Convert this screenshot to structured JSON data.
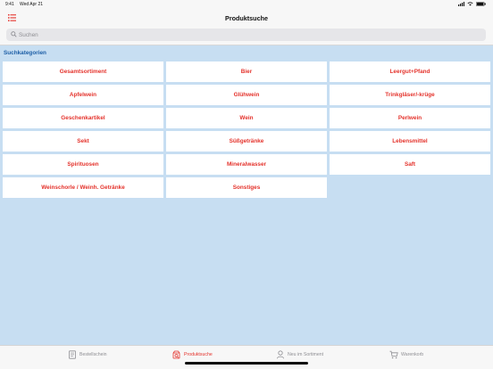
{
  "status": {
    "time": "9:41",
    "date": "Wed Apr 21",
    "battery": "100%"
  },
  "nav": {
    "title": "Produktsuche"
  },
  "search": {
    "placeholder": "Suchen"
  },
  "section": {
    "title": "Suchkategorien"
  },
  "categories": [
    "Gesamtsortiment",
    "Bier",
    "Leergut+Pfand",
    "Apfelwein",
    "Glühwein",
    "Trinkgläser/-krüge",
    "Geschenkartikel",
    "Wein",
    "Perlwein",
    "Sekt",
    "Süßgetränke",
    "Lebensmittel",
    "Spirituosen",
    "Mineralwasser",
    "Saft",
    "Weinschorle / Weinh. Getränke",
    "Sonstiges"
  ],
  "tabs": [
    {
      "label": "Bestellschein",
      "icon": "order-form-icon"
    },
    {
      "label": "Produktsuche",
      "icon": "product-search-icon"
    },
    {
      "label": "Neu im Sortiment",
      "icon": "new-items-icon"
    },
    {
      "label": "Warenkorb",
      "icon": "cart-icon"
    }
  ],
  "colors": {
    "accent": "#e4322b",
    "section": "#1c5ea6",
    "background": "#c7def2",
    "inactive": "#8e8e93"
  }
}
